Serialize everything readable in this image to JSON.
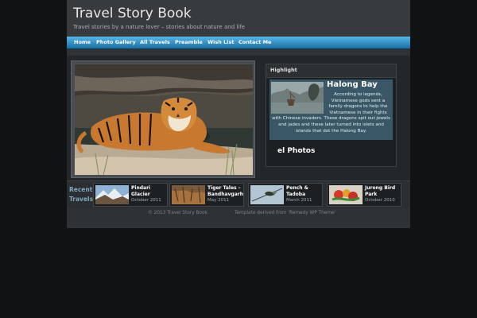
{
  "site": {
    "title": "Travel Story Book",
    "tagline": "Travel stories by a nature lover – stories about nature and life"
  },
  "nav": {
    "items": [
      {
        "label": "Home"
      },
      {
        "label": "Photo Gallery"
      },
      {
        "label": "All Travels"
      },
      {
        "label": "Preamble"
      },
      {
        "label": "Wish List"
      },
      {
        "label": "Contact Me"
      }
    ]
  },
  "highlight": {
    "heading": "Highlight",
    "post_title": "Halong Bay",
    "excerpt": "According to legends, Vietnamese gods sent a family dragons to help the Vietnamese in their fights with Chinese invaders. These dragons spit out jewels and jades and these later turned into islets and islands that dot the Halong Bay.",
    "excerpt_float": "According to legends, Vietnamese gods sent a family dragons to help the Vietnamese in their fights",
    "excerpt_rest": "with Chinese invaders. These dragons spit out jewels and jades and these later turned into islets and islands that dot the Halong Bay.",
    "gallery_peek": "el Photos"
  },
  "recent": {
    "label": "Recent Travels",
    "items": [
      {
        "title": "Pindari Glacier",
        "date": "October 2011",
        "icon": "mountain-photo"
      },
      {
        "title": "Tiger Tales – Bandhavgarh",
        "date": "May 2011",
        "icon": "forest-photo"
      },
      {
        "title": "Pench & Tadoba",
        "date": "March 2011",
        "icon": "bird-photo"
      },
      {
        "title": "Jurong Bird Park",
        "date": "October 2010",
        "icon": "fruit-photo"
      }
    ]
  },
  "footer": {
    "copyright": "© 2013 Travel Story Book",
    "credit": "Template derived from 'Remedy WP Theme'"
  },
  "colors": {
    "nav_gradient_top": "#56b6ea",
    "nav_gradient_bottom": "#1b6d9f",
    "highlight_card": "#395766",
    "recent_label": "#7fa6be"
  }
}
